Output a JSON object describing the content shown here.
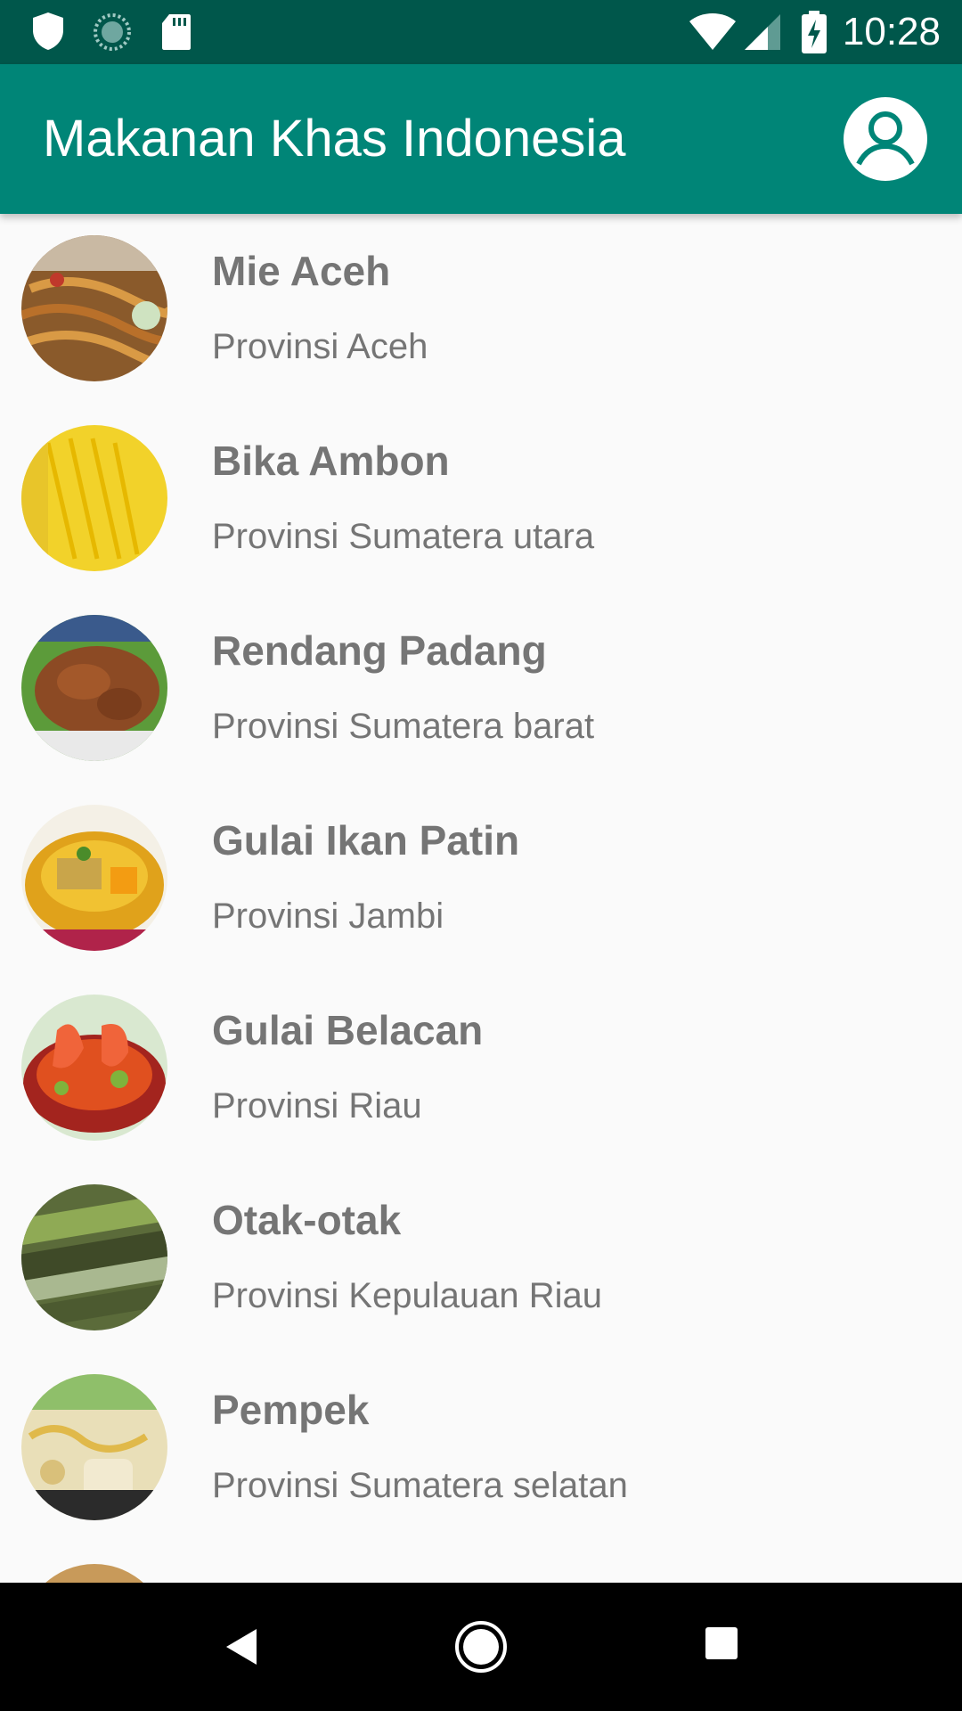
{
  "status_bar": {
    "time": "10:28",
    "icons": [
      "shield-icon",
      "sync-icon",
      "sd-card-icon",
      "wifi-icon",
      "signal-icon",
      "battery-charging-icon"
    ]
  },
  "app_bar": {
    "title": "Makanan Khas Indonesia",
    "profile_icon": "account-circle-icon",
    "color": "#008577",
    "status_color": "#00574b"
  },
  "items": [
    {
      "name": "Mie Aceh",
      "province": "Provinsi Aceh"
    },
    {
      "name": "Bika Ambon",
      "province": "Provinsi Sumatera utara"
    },
    {
      "name": "Rendang Padang",
      "province": "Provinsi Sumatera barat"
    },
    {
      "name": "Gulai Ikan Patin",
      "province": "Provinsi Jambi"
    },
    {
      "name": "Gulai Belacan",
      "province": "Provinsi Riau"
    },
    {
      "name": "Otak-otak",
      "province": "Provinsi Kepulauan Riau"
    },
    {
      "name": "Pempek",
      "province": "Provinsi Sumatera selatan"
    }
  ],
  "nav_bar": {
    "buttons": [
      "back-icon",
      "home-icon",
      "recents-icon"
    ]
  }
}
